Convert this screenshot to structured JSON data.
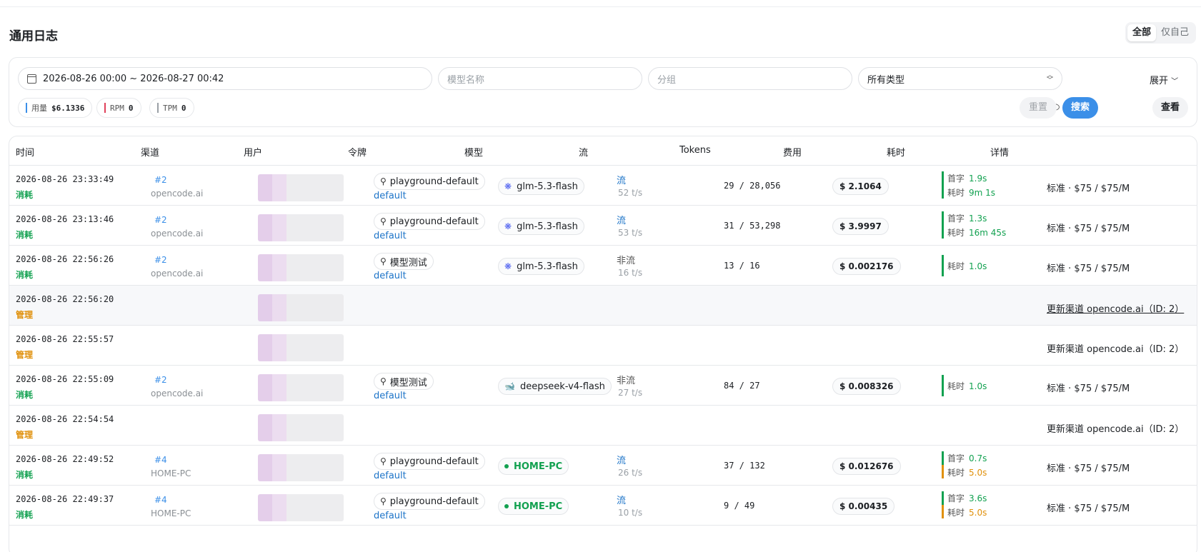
{
  "page": {
    "title": "通用日志"
  },
  "scope": {
    "all": "全部",
    "mine": "仅自己"
  },
  "filters": {
    "date_range": "2026-08-26 00:00 ~ 2026-08-27 00:42",
    "model_placeholder": "模型名称",
    "group_placeholder": "分组",
    "type_value": "所有类型",
    "expand_label": "展开",
    "expand_icon": "chevron-down-icon"
  },
  "stats": [
    {
      "label": "用量",
      "value": "$6.1336",
      "color": "#3b8fe8"
    },
    {
      "label": "RPM",
      "value": "0",
      "color": "#e0405a"
    },
    {
      "label": "TPM",
      "value": "0",
      "color": "#9aa0a6"
    }
  ],
  "actions": {
    "reset": "重置",
    "search": "搜索",
    "view": "查看"
  },
  "columns": [
    "时间",
    "渠道",
    "用户",
    "令牌",
    "模型",
    "流",
    "Tokens",
    "费用",
    "耗时",
    "详情"
  ],
  "colors": {
    "consume": "#12a150",
    "admin": "#e0900a",
    "stream": "#1d74c8",
    "latency_green": "#12a150",
    "latency_orange": "#e0900a",
    "accent": "#3b8fe8"
  },
  "rows": [
    {
      "time": "2026-08-26 23:33:49",
      "type": "消耗",
      "kind": "consume",
      "channel_id": "#2",
      "channel_name": "opencode.ai",
      "token": "playground-default",
      "group": "default",
      "model": "glm-5.3-flash",
      "model_icon": "zhipu-icon",
      "stream": "流",
      "stream_mode": "stream",
      "speed": "52 t/s",
      "tokens": "29 / 28,056",
      "cost": "$ 2.1064",
      "first_label": "首字",
      "first": "1.9s",
      "total_label": "耗时",
      "total": "9m 1s",
      "total_color": "green",
      "detail": "标准 · $75 / $75/M"
    },
    {
      "time": "2026-08-26 23:13:46",
      "type": "消耗",
      "kind": "consume",
      "channel_id": "#2",
      "channel_name": "opencode.ai",
      "token": "playground-default",
      "group": "default",
      "model": "glm-5.3-flash",
      "model_icon": "zhipu-icon",
      "stream": "流",
      "stream_mode": "stream",
      "speed": "53 t/s",
      "tokens": "31 / 53,298",
      "cost": "$ 3.9997",
      "first_label": "首字",
      "first": "1.3s",
      "total_label": "耗时",
      "total": "16m 45s",
      "total_color": "green",
      "detail": "标准 · $75 / $75/M"
    },
    {
      "time": "2026-08-26 22:56:26",
      "type": "消耗",
      "kind": "consume",
      "channel_id": "#2",
      "channel_name": "opencode.ai",
      "token": "模型测试",
      "group": "default",
      "model": "glm-5.3-flash",
      "model_icon": "zhipu-icon",
      "stream": "非流",
      "stream_mode": "nonstream",
      "speed": "16 t/s",
      "tokens": "13 / 16",
      "cost": "$ 0.002176",
      "first_label": "",
      "first": "",
      "total_label": "耗时",
      "total": "1.0s",
      "total_color": "green",
      "detail": "标准 · $75 / $75/M"
    },
    {
      "time": "2026-08-26 22:56:20",
      "type": "管理",
      "kind": "admin",
      "detail": "更新渠道 opencode.ai（ID: 2）",
      "detail_underlined": true
    },
    {
      "time": "2026-08-26 22:55:57",
      "type": "管理",
      "kind": "admin",
      "detail": "更新渠道 opencode.ai（ID: 2）"
    },
    {
      "time": "2026-08-26 22:55:09",
      "type": "消耗",
      "kind": "consume",
      "channel_id": "#2",
      "channel_name": "opencode.ai",
      "token": "模型测试",
      "group": "default",
      "model": "deepseek-v4-flash",
      "model_icon": "whale-icon",
      "stream": "非流",
      "stream_mode": "nonstream",
      "speed": "27 t/s",
      "tokens": "84 / 27",
      "cost": "$ 0.008326",
      "first_label": "",
      "first": "",
      "total_label": "耗时",
      "total": "1.0s",
      "total_color": "green",
      "detail": "标准 · $75 / $75/M"
    },
    {
      "time": "2026-08-26 22:54:54",
      "type": "管理",
      "kind": "admin",
      "detail": "更新渠道 opencode.ai（ID: 2）"
    },
    {
      "time": "2026-08-26 22:49:52",
      "type": "消耗",
      "kind": "consume",
      "channel_id": "#4",
      "channel_name": "HOME-PC",
      "token": "playground-default",
      "group": "default",
      "model": "HOME-PC",
      "model_icon": "dot-icon",
      "stream": "流",
      "stream_mode": "stream",
      "speed": "26 t/s",
      "tokens": "37 / 132",
      "cost": "$ 0.012676",
      "first_label": "首字",
      "first": "0.7s",
      "total_label": "耗时",
      "total": "5.0s",
      "total_color": "orange",
      "detail": "标准 · $75 / $75/M"
    },
    {
      "time": "2026-08-26 22:49:37",
      "type": "消耗",
      "kind": "consume",
      "channel_id": "#4",
      "channel_name": "HOME-PC",
      "token": "playground-default",
      "group": "default",
      "model": "HOME-PC",
      "model_icon": "dot-icon",
      "stream": "流",
      "stream_mode": "stream",
      "speed": "10 t/s",
      "tokens": "9 / 49",
      "cost": "$ 0.00435",
      "first_label": "首字",
      "first": "3.6s",
      "total_label": "耗时",
      "total": "5.0s",
      "total_color": "orange",
      "detail": "标准 · $75 / $75/M"
    }
  ]
}
